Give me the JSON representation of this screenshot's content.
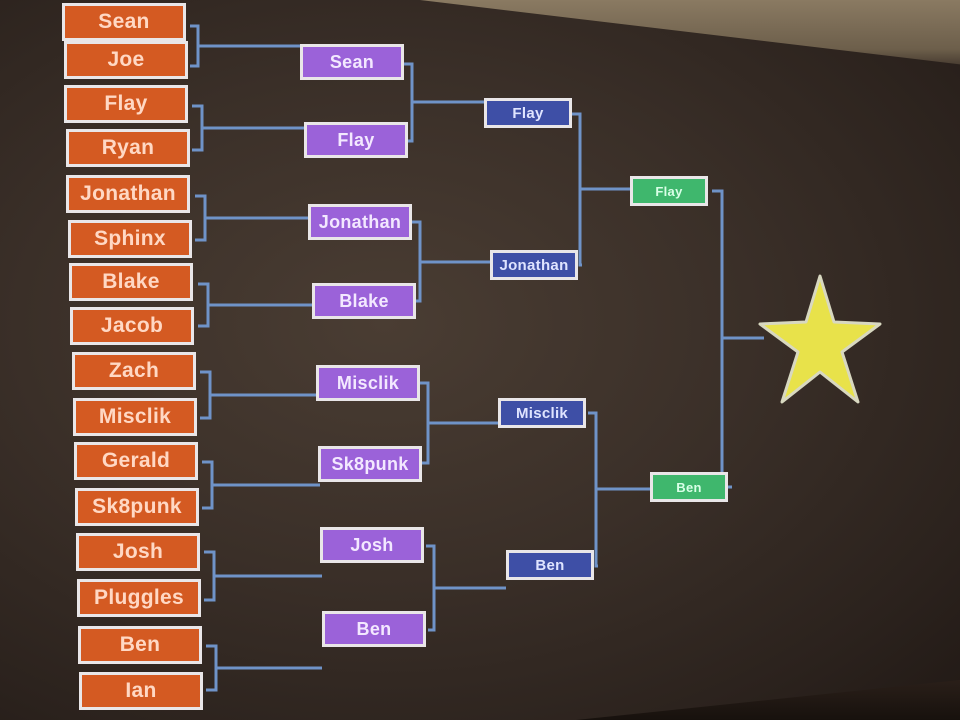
{
  "bracket": {
    "round1": [
      "Sean",
      "Joe",
      "Flay",
      "Ryan",
      "Jonathan",
      "Sphinx",
      "Blake",
      "Jacob",
      "Zach",
      "Misclik",
      "Gerald",
      "Sk8punk",
      "Josh",
      "Pluggles",
      "Ben",
      "Ian"
    ],
    "round2": [
      "Sean",
      "Flay",
      "Jonathan",
      "Blake",
      "Misclik",
      "Sk8punk",
      "Josh",
      "Ben"
    ],
    "semifinals": [
      "Flay",
      "Jonathan",
      "Misclik",
      "Ben"
    ],
    "final": [
      "Flay",
      "Ben"
    ],
    "champion_icon": "star-icon"
  },
  "colors": {
    "round1": "#d45a22",
    "round2": "#9b62d9",
    "semifinals": "#3e4fa6",
    "final": "#3fb76d",
    "star": "#e8e24a",
    "lines": "#6f93c8"
  }
}
